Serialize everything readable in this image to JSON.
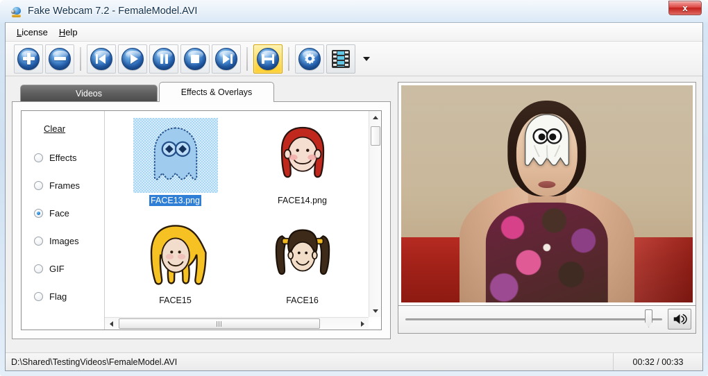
{
  "window": {
    "title": "Fake Webcam 7.2 - FemaleModel.AVI",
    "app_icon": "webcam-icon",
    "close_label": "x",
    "accent_color": "#2f6fc0",
    "selected_toolbutton_color": "#ffcf2e"
  },
  "menubar": {
    "items": [
      {
        "label": "License",
        "accel": "L"
      },
      {
        "label": "Help",
        "accel": "H"
      }
    ]
  },
  "toolbar": {
    "buttons": [
      {
        "name": "add-video-button",
        "icon": "plus-icon",
        "title": "Add"
      },
      {
        "name": "remove-video-button",
        "icon": "minus-icon",
        "title": "Remove"
      },
      {
        "name": "skip-to-start-button",
        "icon": "skip-previous-icon",
        "title": "Previous"
      },
      {
        "name": "play-button",
        "icon": "play-icon",
        "title": "Play"
      },
      {
        "name": "pause-button",
        "icon": "pause-icon",
        "title": "Pause"
      },
      {
        "name": "stop-button",
        "icon": "stop-icon",
        "title": "Stop"
      },
      {
        "name": "skip-to-end-button",
        "icon": "skip-next-icon",
        "title": "Next"
      },
      {
        "name": "effects-overlays-button",
        "icon": "overlay-icon",
        "title": "Effects & Overlays",
        "selected": true
      },
      {
        "name": "settings-button",
        "icon": "gear-icon",
        "title": "Settings"
      },
      {
        "name": "filmstrip-button",
        "icon": "filmstrip-icon",
        "title": "Video"
      }
    ],
    "dropdown_icon": "chevron-down-icon"
  },
  "tabs": [
    {
      "label": "Videos",
      "active": false
    },
    {
      "label": "Effects & Overlays",
      "active": true
    }
  ],
  "effects_panel": {
    "clear_label": "Clear",
    "categories": [
      {
        "label": "Effects",
        "selected": false
      },
      {
        "label": "Frames",
        "selected": false
      },
      {
        "label": "Face",
        "selected": true
      },
      {
        "label": "Images",
        "selected": false
      },
      {
        "label": "GIF",
        "selected": false
      },
      {
        "label": "Flag",
        "selected": false
      }
    ],
    "thumbnails": [
      {
        "label": "FACE13.png",
        "art": "ghost",
        "selected": true
      },
      {
        "label": "FACE14.png",
        "art": "redhead",
        "selected": false
      },
      {
        "label": "FACE15",
        "art": "blonde",
        "selected": false
      },
      {
        "label": "FACE16",
        "art": "pigtails",
        "selected": false
      }
    ],
    "vscrollbar": {
      "up_icon": "caret-up-icon",
      "down_icon": "caret-down-icon"
    },
    "hscrollbar": {
      "left_icon": "caret-left-icon",
      "right_icon": "caret-right-icon"
    }
  },
  "video_preview": {
    "description": "Webcam preview: woman on red couch with white ghost face overlay",
    "overlay_applied": "FACE13.png"
  },
  "video_controls": {
    "volume_slider_name": "volume-slider",
    "volume_value_percent": 92,
    "speaker_icon": "volume-icon"
  },
  "statusbar": {
    "path": "D:\\Shared\\TestingVideos\\FemaleModel.AVI",
    "time": "00:32 / 00:33"
  }
}
